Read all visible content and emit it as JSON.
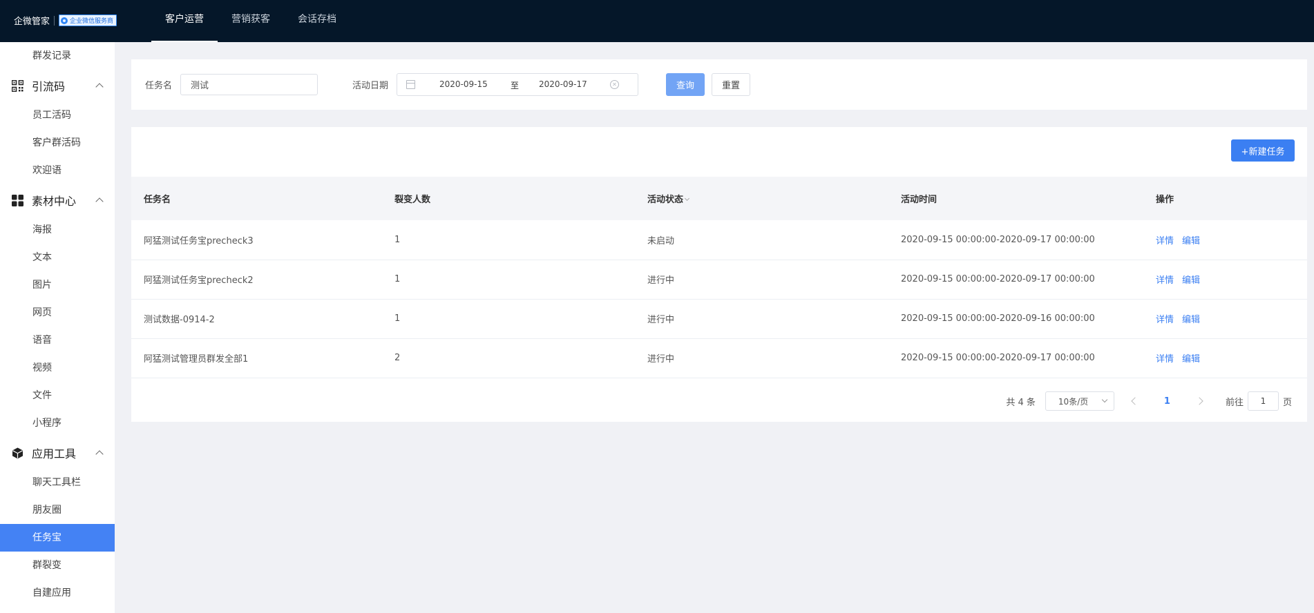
{
  "brand": {
    "name": "企微管家",
    "badge": "企业微信服务商"
  },
  "topnav": [
    {
      "label": "客户运营",
      "active": true
    },
    {
      "label": "营销获客",
      "active": false
    },
    {
      "label": "会话存档",
      "active": false
    }
  ],
  "sidebar": {
    "item_broadcast_records": "群发记录",
    "group_traffic": {
      "label": "引流码",
      "icon": "qrcode-icon"
    },
    "traffic_items": [
      "员工活码",
      "客户群活码",
      "欢迎语"
    ],
    "group_material": {
      "label": "素材中心",
      "icon": "grid-icon"
    },
    "material_items": [
      "海报",
      "文本",
      "图片",
      "网页",
      "语音",
      "视频",
      "文件",
      "小程序"
    ],
    "group_tools": {
      "label": "应用工具",
      "icon": "cube-icon"
    },
    "tools_items": [
      "聊天工具栏",
      "朋友圈",
      "任务宝",
      "群裂变",
      "自建应用"
    ],
    "active_item": "任务宝"
  },
  "filter": {
    "task_name_label": "任务名",
    "task_name_value": "测试",
    "date_label": "活动日期",
    "date_start": "2020-09-15",
    "date_separator": "至",
    "date_end": "2020-09-17",
    "query_button": "查询",
    "reset_button": "重置"
  },
  "table": {
    "new_task_button": "+新建任务",
    "columns": [
      "任务名",
      "裂变人数",
      "活动状态",
      "活动时间",
      "操作"
    ],
    "rows": [
      {
        "name": "阿猛测试任务宝precheck3",
        "count": "1",
        "status": "未启动",
        "time": "2020-09-15 00:00:00-2020-09-17 00:00:00"
      },
      {
        "name": "阿猛测试任务宝precheck2",
        "count": "1",
        "status": "进行中",
        "time": "2020-09-15 00:00:00-2020-09-17 00:00:00"
      },
      {
        "name": "测试数据-0914-2",
        "count": "1",
        "status": "进行中",
        "time": "2020-09-15 00:00:00-2020-09-16 00:00:00"
      },
      {
        "name": "阿猛测试管理员群发全部1",
        "count": "2",
        "status": "进行中",
        "time": "2020-09-15 00:00:00-2020-09-17 00:00:00"
      }
    ],
    "action_detail": "详情",
    "action_edit": "编辑"
  },
  "pagination": {
    "total": "共 4 条",
    "page_size": "10条/页",
    "current_page": "1",
    "goto_prefix": "前往",
    "goto_value": "1",
    "goto_suffix": "页"
  },
  "colors": {
    "topbar": "#051729",
    "primary": "#3b7ff2",
    "sidebar_active": "#4482f4",
    "page_bg": "#f0f1f5"
  }
}
